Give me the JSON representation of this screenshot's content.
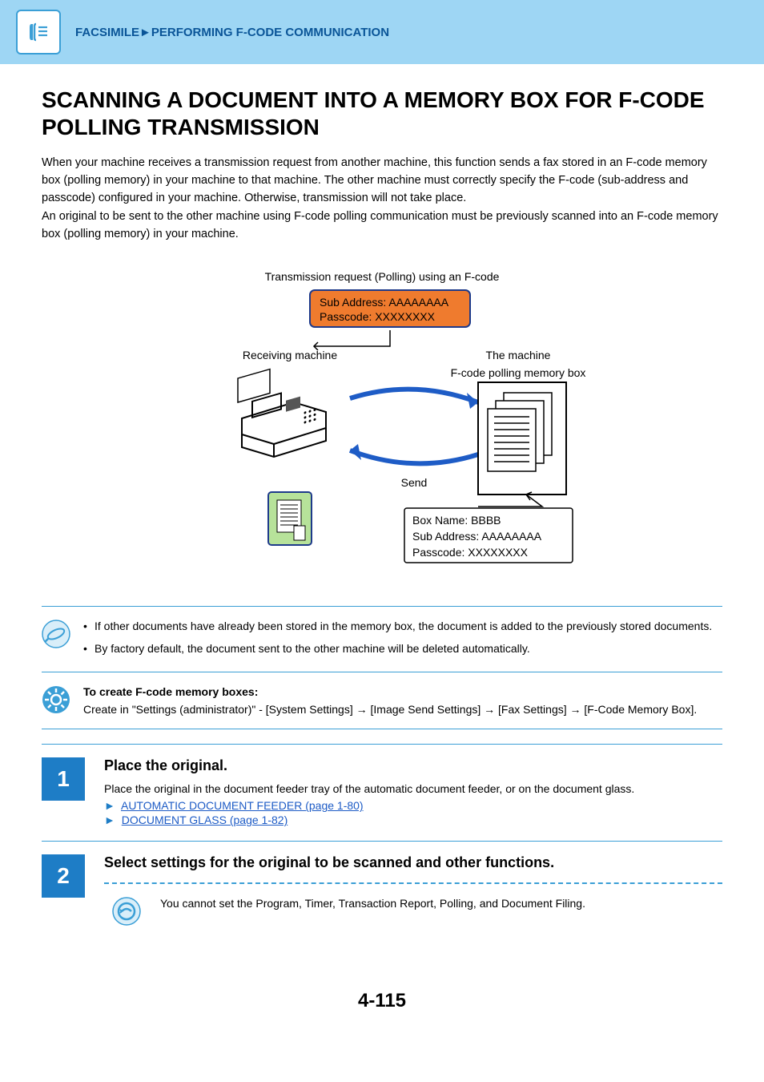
{
  "header": {
    "breadcrumb": "FACSIMILE►PERFORMING F-CODE COMMUNICATION"
  },
  "title": "SCANNING A DOCUMENT INTO A MEMORY BOX FOR F-CODE POLLING TRANSMISSION",
  "intro": {
    "p1": "When your machine receives a transmission request from another machine, this function sends a fax stored in an F-code memory box (polling memory) in your machine to that machine. The other machine must correctly specify the F-code (sub-address and passcode) configured in your machine. Otherwise, transmission will not take place.",
    "p2": "An original to be sent to the other machine using F-code polling communication must be previously scanned into an F-code memory box (polling memory) in your machine."
  },
  "diagram": {
    "title": "Transmission request (Polling) using an F-code",
    "sub_addr": "Sub Address: AAAAAAAA",
    "passcode": "Passcode: XXXXXXXX",
    "recv_label": "Receiving machine",
    "mach_label": "The machine",
    "box_label": "F-code polling memory box",
    "send_label": "Send",
    "box_name": "Box Name: BBBB",
    "box_sub": "Sub Address: AAAAAAAA",
    "box_pass": "Passcode: XXXXXXXX"
  },
  "note1": {
    "b1": "If other documents have already been stored in the memory box, the document is added to the previously stored documents.",
    "b2": "By factory default, the document sent to the other machine will be deleted automatically."
  },
  "note2": {
    "heading": "To create F-code memory boxes:",
    "body": "Create in \"Settings (administrator)\" - [System Settings] → [Image Send Settings] → [Fax Settings] → [F-Code Memory Box]."
  },
  "step1": {
    "num": "1",
    "title": "Place the original.",
    "desc": "Place the original in the document feeder tray of the automatic document feeder, or on the document glass.",
    "link1": "AUTOMATIC DOCUMENT FEEDER (page 1-80)",
    "link2": "DOCUMENT GLASS (page 1-82)"
  },
  "step2": {
    "num": "2",
    "title": "Select settings for the original to be scanned and other functions.",
    "restriction": "You cannot set the Program, Timer, Transaction Report, Polling, and Document Filing."
  },
  "page_number": "4-115"
}
